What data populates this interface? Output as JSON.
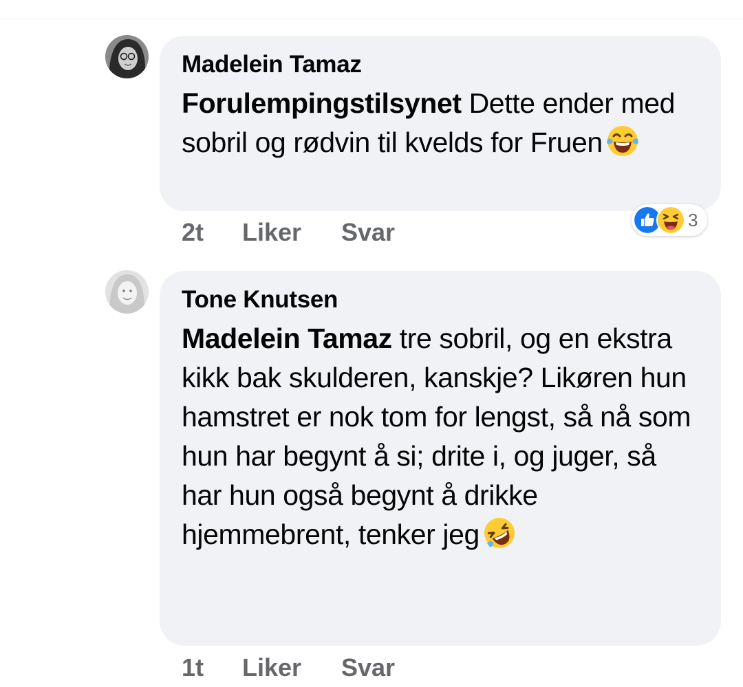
{
  "comments": [
    {
      "author": "Madelein Tamaz",
      "mention": "Forulempingstilsynet",
      "text": " Dette ender med sobril og rødvin til kvelds for Fruen",
      "emoji": "tears-of-joy-emoji",
      "time": "2t",
      "like_label": "Liker",
      "reply_label": "Svar",
      "reactions": {
        "icons": [
          "like-icon",
          "laughing-icon"
        ],
        "count": "3"
      }
    },
    {
      "author": "Tone Knutsen",
      "mention": "Madelein Tamaz",
      "text": " tre sobril, og en ekstra kikk bak skulderen, kanskje? Likøren hun hamstret er nok tom for lengst, så nå som hun har begynt å si; drite i, og juger, så har hun også begynt å drikke hjemmebrent, tenker jeg",
      "emoji": "rolling-on-floor-laughing-emoji",
      "time": "1t",
      "like_label": "Liker",
      "reply_label": "Svar"
    }
  ],
  "colors": {
    "bubble": "#f0f2f5",
    "meta": "#65676b",
    "like_blue": "#1877f2",
    "emoji_yellow": "#ffcc33"
  }
}
